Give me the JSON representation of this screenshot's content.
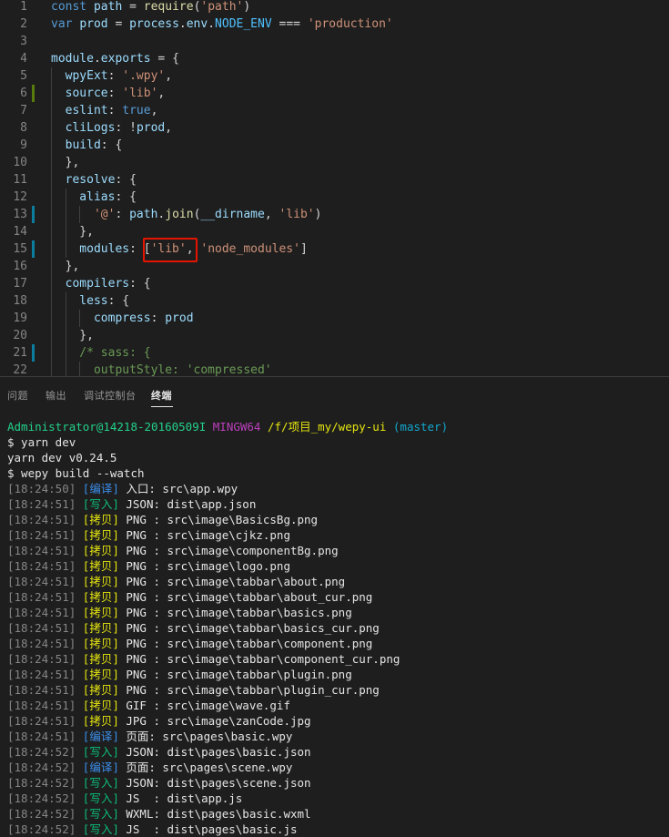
{
  "editor": {
    "lines": [
      {
        "num": "1",
        "tokens": [
          [
            "const ",
            "kw"
          ],
          [
            "path",
            "var"
          ],
          [
            " = ",
            "op"
          ],
          [
            "require",
            "fn"
          ],
          [
            "(",
            "op"
          ],
          [
            "'path'",
            "str"
          ],
          [
            ")",
            "op"
          ]
        ]
      },
      {
        "num": "2",
        "tokens": [
          [
            "var ",
            "kw"
          ],
          [
            "prod",
            "var"
          ],
          [
            " = ",
            "op"
          ],
          [
            "process",
            "var"
          ],
          [
            ".",
            "op"
          ],
          [
            "env",
            "var"
          ],
          [
            ".",
            "op"
          ],
          [
            "NODE_ENV",
            "const"
          ],
          [
            " === ",
            "op"
          ],
          [
            "'production'",
            "str"
          ]
        ]
      },
      {
        "num": "3",
        "tokens": []
      },
      {
        "num": "4",
        "tokens": [
          [
            "module",
            "var"
          ],
          [
            ".",
            "op"
          ],
          [
            "exports",
            "var"
          ],
          [
            " = {",
            "op"
          ]
        ]
      },
      {
        "num": "5",
        "tokens": [
          [
            "  wpyExt",
            "var"
          ],
          [
            ": ",
            "op"
          ],
          [
            "'.wpy'",
            "str"
          ],
          [
            ",",
            "op"
          ]
        ]
      },
      {
        "num": "6",
        "tokens": [
          [
            "  source",
            "var"
          ],
          [
            ": ",
            "op"
          ],
          [
            "'lib'",
            "str"
          ],
          [
            ",",
            "op"
          ]
        ]
      },
      {
        "num": "7",
        "tokens": [
          [
            "  eslint",
            "var"
          ],
          [
            ": ",
            "op"
          ],
          [
            "true",
            "kw"
          ],
          [
            ",",
            "op"
          ]
        ]
      },
      {
        "num": "8",
        "tokens": [
          [
            "  cliLogs",
            "var"
          ],
          [
            ": !",
            "op"
          ],
          [
            "prod",
            "var"
          ],
          [
            ",",
            "op"
          ]
        ]
      },
      {
        "num": "9",
        "tokens": [
          [
            "  build",
            "var"
          ],
          [
            ": {",
            "op"
          ]
        ]
      },
      {
        "num": "10",
        "tokens": [
          [
            "  },",
            "op"
          ]
        ]
      },
      {
        "num": "11",
        "tokens": [
          [
            "  resolve",
            "var"
          ],
          [
            ": {",
            "op"
          ]
        ]
      },
      {
        "num": "12",
        "tokens": [
          [
            "    alias",
            "var"
          ],
          [
            ": {",
            "op"
          ]
        ]
      },
      {
        "num": "13",
        "tokens": [
          [
            "      ",
            "op"
          ],
          [
            "'@'",
            "str"
          ],
          [
            ": ",
            "op"
          ],
          [
            "path",
            "var"
          ],
          [
            ".",
            "op"
          ],
          [
            "join",
            "fn"
          ],
          [
            "(",
            "op"
          ],
          [
            "__dirname",
            "var"
          ],
          [
            ", ",
            "op"
          ],
          [
            "'lib'",
            "str"
          ],
          [
            ")",
            "op"
          ]
        ]
      },
      {
        "num": "14",
        "tokens": [
          [
            "    },",
            "op"
          ]
        ]
      },
      {
        "num": "15",
        "tokens": [
          [
            "    modules",
            "var"
          ],
          [
            ": [",
            "op"
          ],
          [
            "'lib'",
            "str"
          ],
          [
            ", ",
            "op"
          ],
          [
            "'node_modules'",
            "str"
          ],
          [
            "]",
            "op"
          ]
        ]
      },
      {
        "num": "16",
        "tokens": [
          [
            "  },",
            "op"
          ]
        ]
      },
      {
        "num": "17",
        "tokens": [
          [
            "  compilers",
            "var"
          ],
          [
            ": {",
            "op"
          ]
        ]
      },
      {
        "num": "18",
        "tokens": [
          [
            "    less",
            "var"
          ],
          [
            ": {",
            "op"
          ]
        ]
      },
      {
        "num": "19",
        "tokens": [
          [
            "      compress",
            "var"
          ],
          [
            ": ",
            "op"
          ],
          [
            "prod",
            "var"
          ]
        ]
      },
      {
        "num": "20",
        "tokens": [
          [
            "    },",
            "op"
          ]
        ]
      },
      {
        "num": "21",
        "tokens": [
          [
            "    /* sass: {",
            "cmt"
          ]
        ]
      },
      {
        "num": "22",
        "tokens": [
          [
            "      outputStyle: 'compressed'",
            "cmt"
          ]
        ]
      }
    ],
    "modified_lines": [
      "6",
      "13",
      "15",
      "21"
    ]
  },
  "panel": {
    "tabs": [
      {
        "label": "问题",
        "active": false
      },
      {
        "label": "输出",
        "active": false
      },
      {
        "label": "调试控制台",
        "active": false
      },
      {
        "label": "终端",
        "active": true
      }
    ]
  },
  "terminal": {
    "prompt": {
      "user": "Administrator@14218-20160509I",
      "shell": "MINGW64",
      "path": "/f/项目_my/wepy-ui",
      "branch": "(master)"
    },
    "commands": [
      "$ yarn dev",
      "yarn dev v0.24.5",
      "$ wepy build --watch"
    ],
    "log": [
      {
        "time": "[18:24:50]",
        "tag": "[编译]",
        "kind": "compile",
        "text": "入口: src\\app.wpy"
      },
      {
        "time": "[18:24:51]",
        "tag": "[写入]",
        "kind": "write",
        "text": "JSON: dist\\app.json"
      },
      {
        "time": "[18:24:51]",
        "tag": "[拷贝]",
        "kind": "copy",
        "text": "PNG : src\\image\\BasicsBg.png"
      },
      {
        "time": "[18:24:51]",
        "tag": "[拷贝]",
        "kind": "copy",
        "text": "PNG : src\\image\\cjkz.png"
      },
      {
        "time": "[18:24:51]",
        "tag": "[拷贝]",
        "kind": "copy",
        "text": "PNG : src\\image\\componentBg.png"
      },
      {
        "time": "[18:24:51]",
        "tag": "[拷贝]",
        "kind": "copy",
        "text": "PNG : src\\image\\logo.png"
      },
      {
        "time": "[18:24:51]",
        "tag": "[拷贝]",
        "kind": "copy",
        "text": "PNG : src\\image\\tabbar\\about.png"
      },
      {
        "time": "[18:24:51]",
        "tag": "[拷贝]",
        "kind": "copy",
        "text": "PNG : src\\image\\tabbar\\about_cur.png"
      },
      {
        "time": "[18:24:51]",
        "tag": "[拷贝]",
        "kind": "copy",
        "text": "PNG : src\\image\\tabbar\\basics.png"
      },
      {
        "time": "[18:24:51]",
        "tag": "[拷贝]",
        "kind": "copy",
        "text": "PNG : src\\image\\tabbar\\basics_cur.png"
      },
      {
        "time": "[18:24:51]",
        "tag": "[拷贝]",
        "kind": "copy",
        "text": "PNG : src\\image\\tabbar\\component.png"
      },
      {
        "time": "[18:24:51]",
        "tag": "[拷贝]",
        "kind": "copy",
        "text": "PNG : src\\image\\tabbar\\component_cur.png"
      },
      {
        "time": "[18:24:51]",
        "tag": "[拷贝]",
        "kind": "copy",
        "text": "PNG : src\\image\\tabbar\\plugin.png"
      },
      {
        "time": "[18:24:51]",
        "tag": "[拷贝]",
        "kind": "copy",
        "text": "PNG : src\\image\\tabbar\\plugin_cur.png"
      },
      {
        "time": "[18:24:51]",
        "tag": "[拷贝]",
        "kind": "copy",
        "text": "GIF : src\\image\\wave.gif"
      },
      {
        "time": "[18:24:51]",
        "tag": "[拷贝]",
        "kind": "copy",
        "text": "JPG : src\\image\\zanCode.jpg"
      },
      {
        "time": "[18:24:51]",
        "tag": "[编译]",
        "kind": "compile",
        "text": "页面: src\\pages\\basic.wpy"
      },
      {
        "time": "[18:24:52]",
        "tag": "[写入]",
        "kind": "write",
        "text": "JSON: dist\\pages\\basic.json"
      },
      {
        "time": "[18:24:52]",
        "tag": "[编译]",
        "kind": "compile",
        "text": "页面: src\\pages\\scene.wpy"
      },
      {
        "time": "[18:24:52]",
        "tag": "[写入]",
        "kind": "write",
        "text": "JSON: dist\\pages\\scene.json"
      },
      {
        "time": "[18:24:52]",
        "tag": "[写入]",
        "kind": "write",
        "text": "JS  : dist\\app.js"
      },
      {
        "time": "[18:24:52]",
        "tag": "[写入]",
        "kind": "write",
        "text": "WXML: dist\\pages\\basic.wxml"
      },
      {
        "time": "[18:24:52]",
        "tag": "[写入]",
        "kind": "write",
        "text": "JS  : dist\\pages\\basic.js"
      }
    ]
  },
  "colors": {
    "background": "#1e1e1e",
    "highlight_box": "#e51400",
    "modified_marker": "#0c7d9d",
    "added_marker": "#587c0c"
  }
}
